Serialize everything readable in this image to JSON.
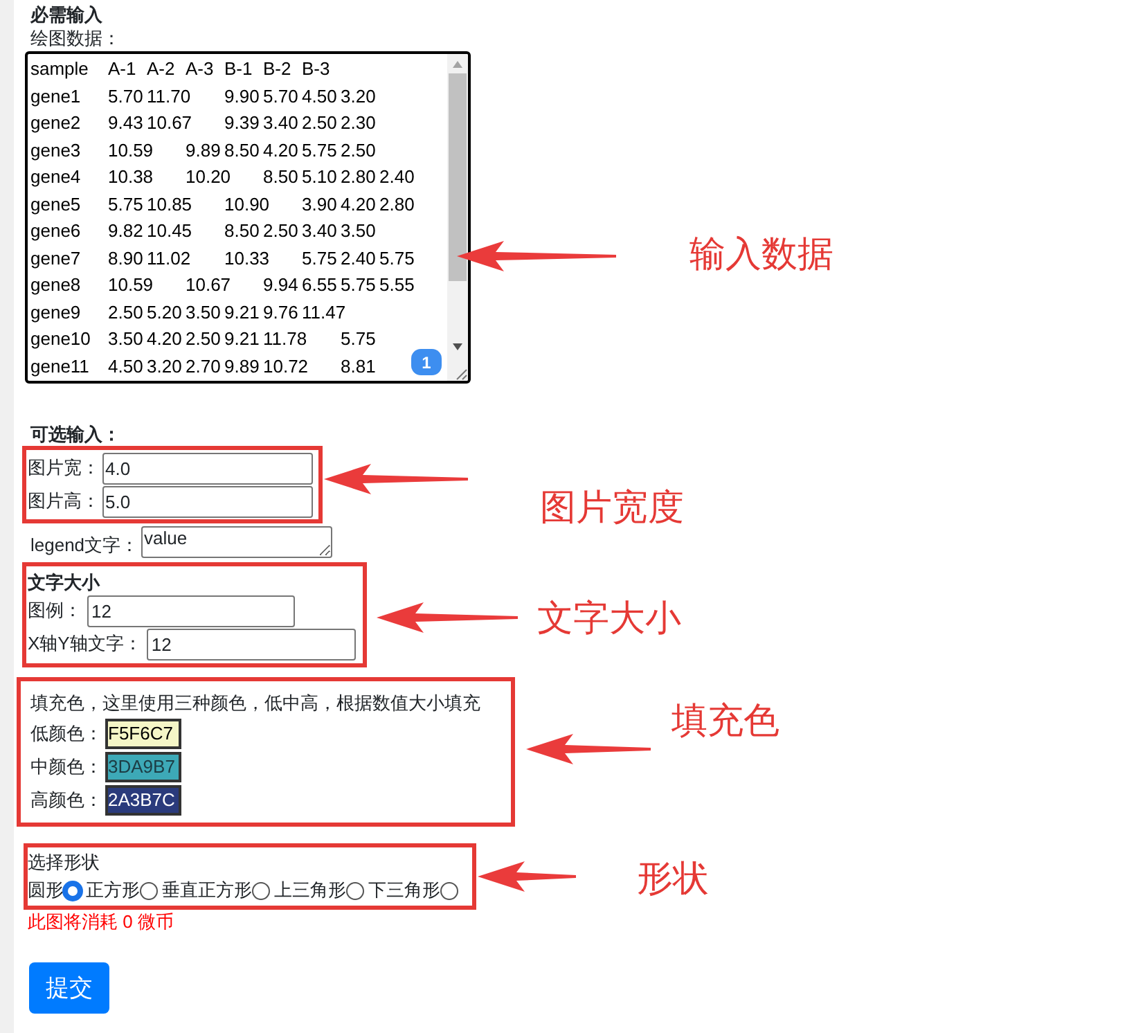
{
  "required": {
    "heading": "必需输入",
    "data_label": "绘图数据：",
    "data_lines": [
      "sample\tA-1\tA-2\tA-3\tB-1\tB-2\tB-3",
      "gene1\t5.70\t11.70\t9.90\t5.70\t4.50\t3.20",
      "gene2\t9.43\t10.67\t9.39\t3.40\t2.50\t2.30",
      "gene3\t10.59\t9.89\t8.50\t4.20\t5.75\t2.50",
      "gene4\t10.38\t10.20\t8.50\t5.10\t2.80\t2.40",
      "gene5\t5.75\t10.85\t10.90\t3.90\t4.20\t2.80",
      "gene6\t9.82\t10.45\t8.50\t2.50\t3.40\t3.50",
      "gene7\t8.90\t11.02\t10.33\t5.75\t2.40\t5.75",
      "gene8\t10.59\t10.67\t9.94\t6.55\t5.75\t5.55",
      "gene9\t2.50\t5.20\t3.50\t9.21\t9.76\t11.47",
      "gene10\t3.50\t4.20\t2.50\t9.21\t11.78\t5.75",
      "gene11\t4.50\t3.20\t2.70\t9.89\t10.72\t8.81"
    ],
    "badge": "1"
  },
  "optional": {
    "heading": "可选输入：",
    "size_fields": [
      {
        "label": "图片宽：",
        "value": "4.0"
      },
      {
        "label": "图片高：",
        "value": "5.0"
      }
    ],
    "legend": {
      "label": "legend文字：",
      "value": "value"
    },
    "font_size": {
      "heading": "文字大小",
      "fields": [
        {
          "label": "图例：",
          "value": "12"
        },
        {
          "label": "X轴Y轴文字：",
          "value": "12"
        }
      ]
    },
    "fill": {
      "description": "填充色，这里使用三种颜色，低中高，根据数值大小填充",
      "colors": [
        {
          "label": "低颜色：",
          "value": "F5F6C7",
          "color": "#f5f6c7"
        },
        {
          "label": "中颜色：",
          "value": "3DA9B7",
          "color": "#3da9b7"
        },
        {
          "label": "高颜色：",
          "value": "2A3B7C",
          "color": "#2a3b7c"
        }
      ]
    },
    "shape": {
      "heading": "选择形状",
      "options": [
        {
          "label": "圆形",
          "selected": true
        },
        {
          "label": "正方形",
          "selected": false
        },
        {
          "label": "垂直正方形",
          "selected": false
        },
        {
          "label": "上三角形",
          "selected": false
        },
        {
          "label": "下三角形",
          "selected": false
        }
      ]
    }
  },
  "cost_note": "此图将消耗 0 微币",
  "submit": "提交",
  "annotations": [
    {
      "text": "输入数据"
    },
    {
      "text": "图片宽度"
    },
    {
      "text": "文字大小"
    },
    {
      "text": "填充色"
    },
    {
      "text": "形状"
    }
  ]
}
